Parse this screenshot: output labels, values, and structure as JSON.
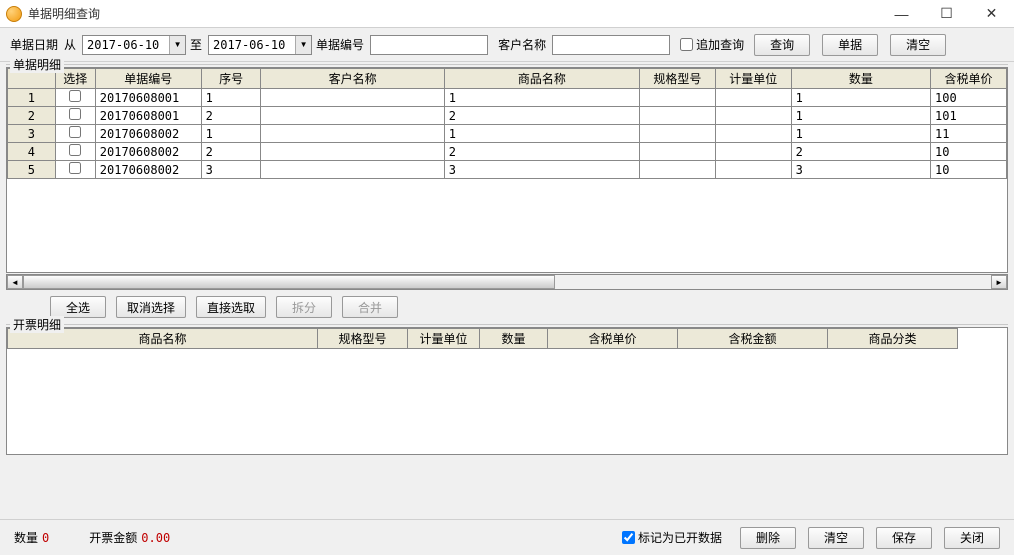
{
  "window": {
    "title": "单据明细查询"
  },
  "toolbar": {
    "date_label": "单据日期",
    "from_label": "从",
    "to_label": "至",
    "date_from": "2017-06-10",
    "date_to": "2017-06-10",
    "doc_no_label": "单据编号",
    "doc_no_value": "",
    "customer_label": "客户名称",
    "customer_value": "",
    "append_query_label": "追加查询",
    "query_btn": "查询",
    "doc_btn": "单据",
    "clear_btn": "清空"
  },
  "detail_group_label": "单据明细",
  "detail_columns": {
    "rownum": "",
    "select": "选择",
    "doc_no": "单据编号",
    "seq": "序号",
    "customer": "客户名称",
    "product": "商品名称",
    "spec": "规格型号",
    "unit": "计量单位",
    "qty": "数量",
    "price": "含税单价"
  },
  "detail_rows": [
    {
      "rownum": "1",
      "doc_no": "20170608001",
      "seq": "1",
      "customer": "",
      "product": "1",
      "spec": "",
      "unit": "",
      "qty": "1",
      "price": "100"
    },
    {
      "rownum": "2",
      "doc_no": "20170608001",
      "seq": "2",
      "customer": "",
      "product": "2",
      "spec": "",
      "unit": "",
      "qty": "1",
      "price": "101"
    },
    {
      "rownum": "3",
      "doc_no": "20170608002",
      "seq": "1",
      "customer": "",
      "product": "1",
      "spec": "",
      "unit": "",
      "qty": "1",
      "price": "11"
    },
    {
      "rownum": "4",
      "doc_no": "20170608002",
      "seq": "2",
      "customer": "",
      "product": "2",
      "spec": "",
      "unit": "",
      "qty": "2",
      "price": "10"
    },
    {
      "rownum": "5",
      "doc_no": "20170608002",
      "seq": "3",
      "customer": "",
      "product": "3",
      "spec": "",
      "unit": "",
      "qty": "3",
      "price": "10"
    }
  ],
  "mid_buttons": {
    "select_all": "全选",
    "deselect": "取消选择",
    "direct_pick": "直接选取",
    "split": "拆分",
    "merge": "合并"
  },
  "invoice_group_label": "开票明细",
  "invoice_columns": {
    "product": "商品名称",
    "spec": "规格型号",
    "unit": "计量单位",
    "qty": "数量",
    "price": "含税单价",
    "amount": "含税金额",
    "category": "商品分类"
  },
  "bottom": {
    "qty_label": "数量",
    "qty_value": "0",
    "amount_label": "开票金额",
    "amount_value": "0.00",
    "mark_checkbox_label": "标记为已开数据",
    "mark_checked": true,
    "delete_btn": "删除",
    "clear_btn": "清空",
    "save_btn": "保存",
    "close_btn": "关闭"
  }
}
